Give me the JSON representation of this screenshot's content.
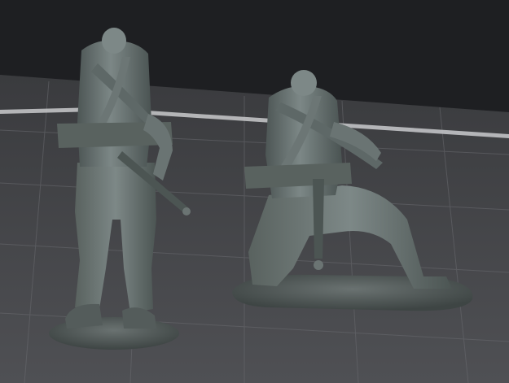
{
  "scene": {
    "kind": "3d-viewport-render",
    "subjects": [
      "standing-miniature-figure",
      "kneeling-miniature-figure"
    ],
    "colors": {
      "backdrop": "#1e1f22",
      "bed": "#4b4c50",
      "bed_far": "#3a3b3e",
      "grid": "#6a6b70",
      "bed_edge": "#c9cacc",
      "model_light": "#8a9493",
      "model_mid": "#66706f",
      "model_dark": "#3f4746",
      "base": "#555c5b"
    }
  }
}
